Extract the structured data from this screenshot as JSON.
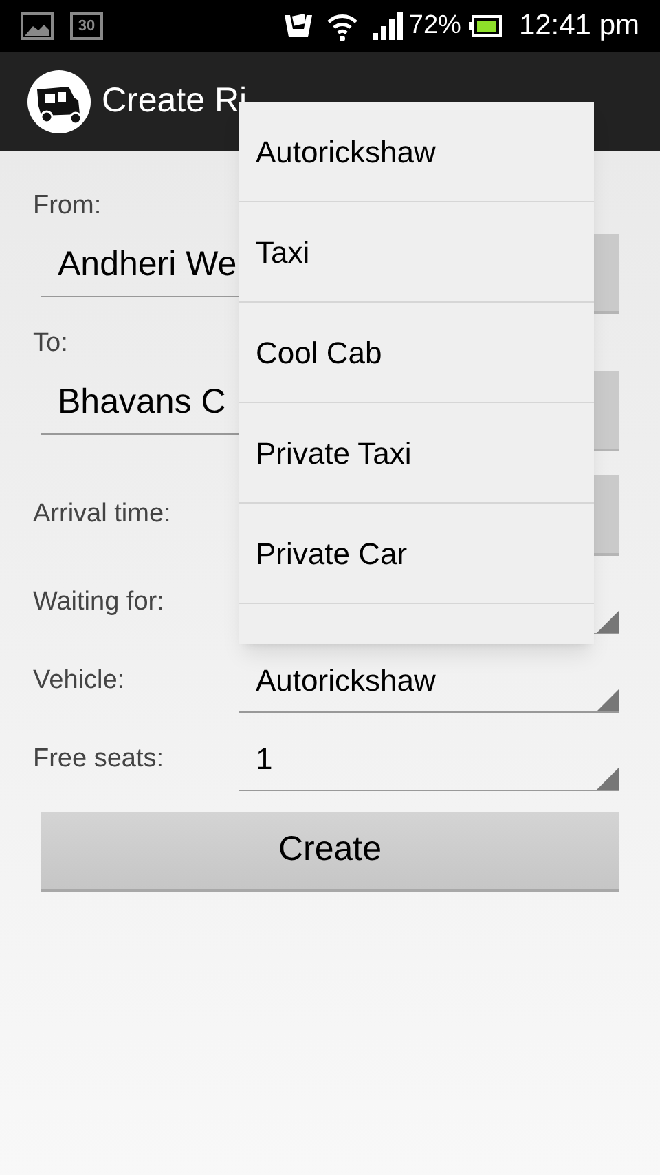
{
  "status_bar": {
    "calendar_day": "30",
    "battery": "72%",
    "time": "12:41 pm"
  },
  "action_bar": {
    "title": "Create Ri"
  },
  "form": {
    "fields": [
      {
        "kind": "text",
        "label": "From:",
        "value": "Andheri We"
      },
      {
        "kind": "text",
        "label": "To:",
        "value": "Bhavans C"
      },
      {
        "kind": "button",
        "label": "Arrival time:"
      },
      {
        "kind": "spinner",
        "label": "Waiting for:"
      },
      {
        "kind": "spinner",
        "label": "Vehicle:",
        "value": "Autorickshaw"
      },
      {
        "kind": "spinner",
        "label": "Free seats:",
        "value": "1"
      }
    ],
    "submit": "Create"
  },
  "dropdown_menu": {
    "items": [
      {
        "label": "Autorickshaw"
      },
      {
        "label": "Taxi"
      },
      {
        "label": "Cool Cab"
      },
      {
        "label": "Private Taxi"
      },
      {
        "label": "Private Car"
      }
    ]
  }
}
